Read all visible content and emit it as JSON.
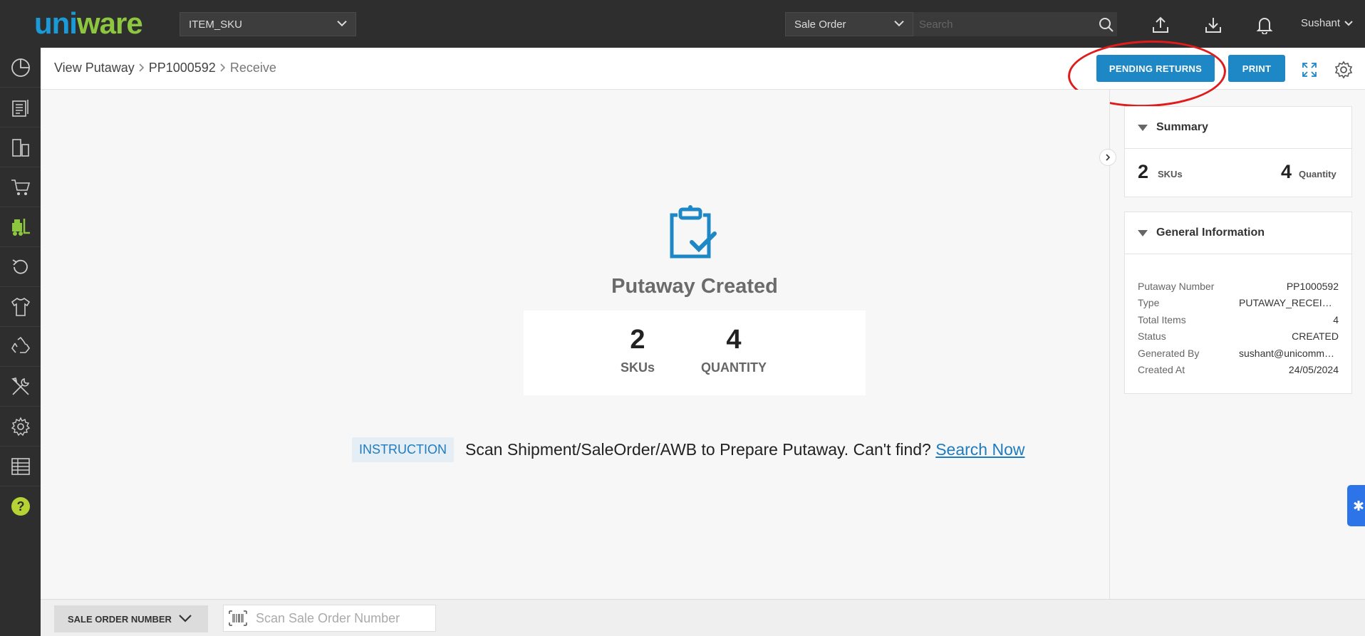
{
  "topbar": {
    "logo_part1": "uni",
    "logo_part2": "ware",
    "facility_select": "ITEM_SKU",
    "search_type_select": "Sale Order",
    "search_placeholder": "Search",
    "user_name": "Sushant"
  },
  "sidebar": {
    "items": [
      "dashboard-icon",
      "orders-icon",
      "shipments-icon",
      "cart-icon",
      "putaway-icon",
      "returns-icon",
      "products-icon",
      "recycle-icon",
      "tools-icon",
      "settings-icon",
      "reports-icon",
      "help-icon"
    ]
  },
  "header": {
    "breadcrumb": [
      "View Putaway",
      "PP1000592",
      "Receive"
    ],
    "pending_returns_label": "PENDING RETURNS",
    "print_label": "PRINT"
  },
  "main": {
    "title": "Putaway Created",
    "skus_value": "2",
    "skus_label": "SKUs",
    "quantity_value": "4",
    "quantity_label": "QUANTITY",
    "instruction_tag": "INSTRUCTION",
    "instruction_text": "Scan Shipment/SaleOrder/AWB to Prepare Putaway. Can't find?",
    "search_now": "Search Now"
  },
  "summary": {
    "title": "Summary",
    "skus_value": "2",
    "skus_label": "SKUs",
    "quantity_value": "4",
    "quantity_label": "Quantity"
  },
  "general_info": {
    "title": "General Information",
    "rows": [
      {
        "key": "Putaway Number",
        "value": "PP1000592"
      },
      {
        "key": "Type",
        "value": "PUTAWAY_RECEIVED_RETURNS"
      },
      {
        "key": "Total Items",
        "value": "4"
      },
      {
        "key": "Status",
        "value": "CREATED"
      },
      {
        "key": "Generated By",
        "value": "sushant@unicommerce.com"
      },
      {
        "key": "Created At",
        "value": "24/05/2024"
      }
    ]
  },
  "bottombar": {
    "scan_type": "SALE ORDER NUMBER",
    "scan_placeholder": "Scan Sale Order Number"
  },
  "colors": {
    "accent": "#1e88c7",
    "annotation": "#e01b1b",
    "logo_blue": "#1a9ad6",
    "logo_green": "#8dc63f",
    "active_sidebar": "#8dc63f"
  }
}
